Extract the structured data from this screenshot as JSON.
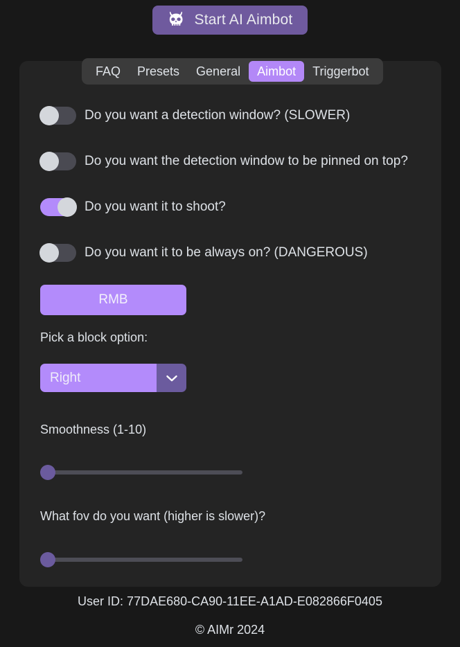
{
  "colors": {
    "background": "#181818",
    "panel": "#242424",
    "accent_light": "#b38bfb",
    "accent_dark": "#6b5b9e",
    "start_button": "#6f5a9e",
    "tabbar": "#3b3b3b",
    "text": "#dde1e6",
    "switch_off_track": "#4a4a52",
    "switch_knob": "#d4d7dc",
    "slider_track": "#4d4d56"
  },
  "start_button": {
    "label": "Start AI Aimbot",
    "icon": "horned-skull-icon"
  },
  "tabs": [
    {
      "label": "FAQ",
      "active": false
    },
    {
      "label": "Presets",
      "active": false
    },
    {
      "label": "General",
      "active": false
    },
    {
      "label": "Aimbot",
      "active": true
    },
    {
      "label": "Triggerbot",
      "active": false
    }
  ],
  "toggles": [
    {
      "label": "Do you want a detection window? (SLOWER)",
      "on": false
    },
    {
      "label": "Do you want the detection window to be pinned on top?",
      "on": false
    },
    {
      "label": "Do you want it to shoot?",
      "on": true
    },
    {
      "label": "Do you want it to be always on? (DANGEROUS)",
      "on": false
    }
  ],
  "keybind_button": {
    "label": "RMB"
  },
  "block_option": {
    "label": "Pick a block option:",
    "selected": "Right",
    "arrow_icon": "chevron-down-icon"
  },
  "sliders": [
    {
      "label": "Smoothness (1-10)",
      "value": 0,
      "min": 1,
      "max": 10
    },
    {
      "label": "What fov do you want (higher is slower)?",
      "value": 0
    }
  ],
  "footer": {
    "user_id": "User ID: 77DAE680-CA90-11EE-A1AD-E082866F0405",
    "copyright": "© AIMr 2024"
  }
}
